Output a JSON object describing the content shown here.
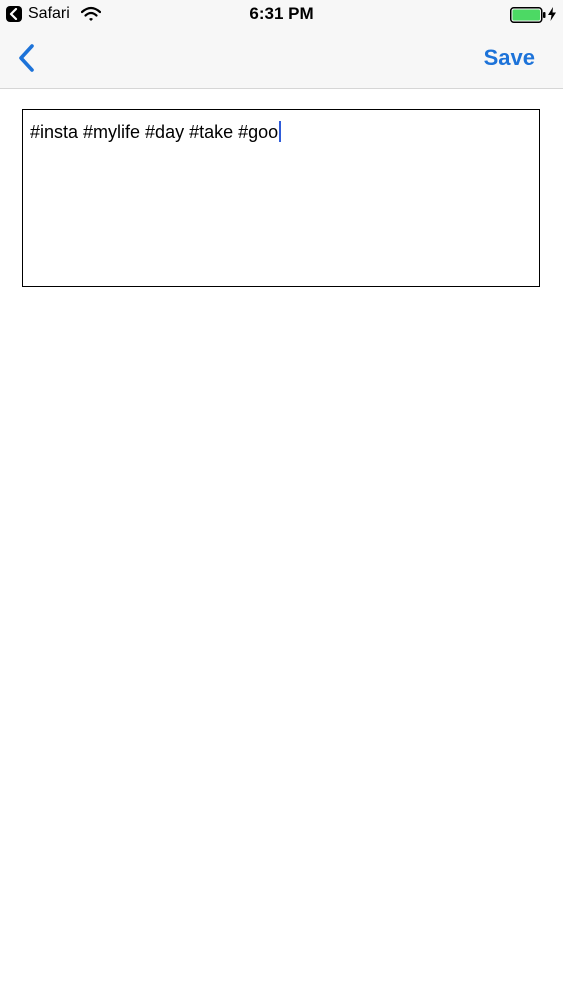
{
  "status_bar": {
    "back_app_label": "Safari",
    "time": "6:31 PM",
    "battery_color": "#4cd964"
  },
  "nav_bar": {
    "back_icon": "chevron-left-icon",
    "save_label": "Save",
    "accent_color": "#1d73d9"
  },
  "editor": {
    "value": "#insta #mylife #day #take #goo"
  }
}
